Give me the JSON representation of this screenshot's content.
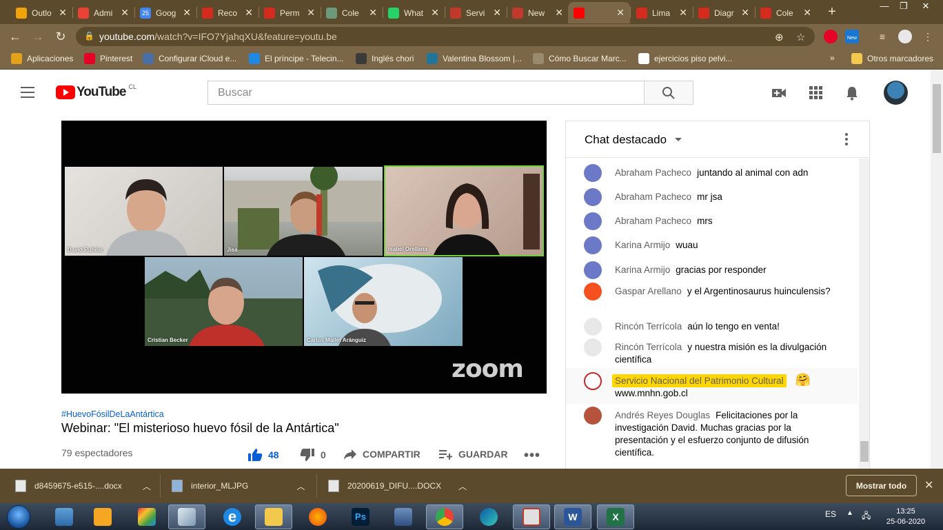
{
  "browser": {
    "tabs": [
      {
        "label": "Outlo",
        "color": "#f0a30a"
      },
      {
        "label": "Admi",
        "color": "#ea4335"
      },
      {
        "label": "Goog",
        "color": "#4285f4",
        "badge": "25"
      },
      {
        "label": "Reco",
        "color": "#d52b1e"
      },
      {
        "label": "Perm",
        "color": "#d52b1e"
      },
      {
        "label": "Cole",
        "color": "#6a9a7a"
      },
      {
        "label": "What",
        "color": "#25d366"
      },
      {
        "label": "Servi",
        "color": "#c0392b"
      },
      {
        "label": "New",
        "color": "#c0392b"
      },
      {
        "label": "",
        "color": "#ff0000"
      },
      {
        "label": "Lima",
        "color": "#d52b1e"
      },
      {
        "label": "Diagr",
        "color": "#d52b1e"
      },
      {
        "label": "Cole",
        "color": "#d52b1e"
      }
    ],
    "url_host": "youtube.com",
    "url_path": "/watch?v=IFO7YjahqXU&feature=youtu.be",
    "ext_new_badge": "New",
    "bookmarks": [
      {
        "label": "Aplicaciones",
        "color": "#e4a11b"
      },
      {
        "label": "Pinterest",
        "color": "#e60023"
      },
      {
        "label": "Configurar iCloud e...",
        "color": "#4a6fa5"
      },
      {
        "label": "El príncipe - Telecin...",
        "color": "#1e88e5"
      },
      {
        "label": "Inglés chori",
        "color": "#3a3a3a"
      },
      {
        "label": "Valentina Blossom |...",
        "color": "#21759b"
      },
      {
        "label": "Cómo Buscar Marc...",
        "color": "#9a8a70"
      },
      {
        "label": "ejercicios piso pelvi...",
        "color": "#ffffff"
      }
    ],
    "bookmarks_overflow": "»",
    "other_bookmarks": "Otros marcadores"
  },
  "youtube": {
    "logo_text": "YouTube",
    "country": "CL",
    "search_placeholder": "Buscar"
  },
  "video": {
    "participants": [
      {
        "name": "David Rubilar"
      },
      {
        "name": "Jisa"
      },
      {
        "name": "Isabel Orellana"
      },
      {
        "name": "Cristian Becker"
      },
      {
        "name": "Carlos Mallet Aránguiz"
      }
    ],
    "watermark": "zoom",
    "hashtag": "#HuevoFósilDeLaAntártica",
    "title": "Webinar: \"El misterioso huevo fósil de la Antártica\"",
    "viewers": "79 espectadores",
    "likes": "48",
    "dislikes": "0",
    "share": "COMPARTIR",
    "save": "GUARDAR"
  },
  "chat": {
    "title": "Chat destacado",
    "messages": [
      {
        "author": "Abraham Pacheco",
        "text": "juntando al animal con adn",
        "avatar": "#6b79c6"
      },
      {
        "author": "Abraham Pacheco",
        "text": "mr jsa",
        "avatar": "#6b79c6"
      },
      {
        "author": "Abraham Pacheco",
        "text": "mrs",
        "avatar": "#6b79c6"
      },
      {
        "author": "Karina Armijo",
        "text": "wuau",
        "avatar": "#6b79c6"
      },
      {
        "author": "Karina Armijo",
        "text": "gracias por responder",
        "avatar": "#6b79c6"
      },
      {
        "author": "Gaspar Arellano",
        "text": "y el Argentinosaurus huinculensis?",
        "avatar": "#f4511e"
      },
      {
        "author": "Rincón Terrícola",
        "text": "aún lo tengo en venta!",
        "avatar": "#e8e8e8"
      },
      {
        "author": "Rincón Terrícola",
        "text": "y nuestra misión es la divulgación científica",
        "avatar": "#e8e8e8"
      },
      {
        "author": "Servicio Nacional del Patrimonio Cultural",
        "text": "www.mnhn.gob.cl",
        "avatar": "#ffffff",
        "owner": true,
        "emoji": "🤗"
      },
      {
        "author": "Andrés Reyes Douglas",
        "text": "Felicitaciones por la investigación David. Muchas gracias por la presentación y el esfuerzo conjunto de difusión científica.",
        "avatar": "#b5533c"
      }
    ]
  },
  "downloads": {
    "items": [
      "d8459675-e515-....docx",
      "interior_MLJPG",
      "20200619_DIFU....DOCX"
    ],
    "show_all": "Mostrar todo"
  },
  "taskbar": {
    "lang": "ES",
    "time": "13:25",
    "date": "25-06-2020"
  }
}
